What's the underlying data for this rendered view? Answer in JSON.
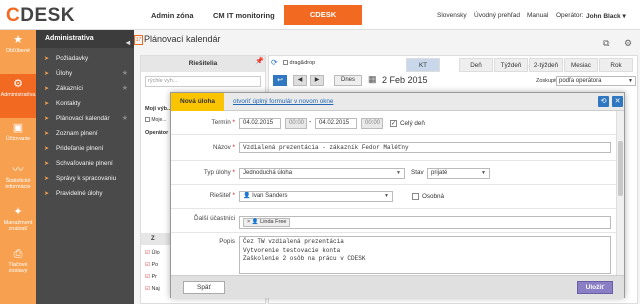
{
  "app": {
    "logo_c": "C",
    "logo_rest": "DESK"
  },
  "topnav": {
    "admin_zone": "Admin zóna",
    "cm_it": "CM IT monitoring",
    "cdesk": "CDESK"
  },
  "topright": {
    "lang": "Slovensky",
    "home": "Úvodný prehľad",
    "manual": "Manual",
    "operator_label": "Operátor:",
    "operator_name": "John Black"
  },
  "leftbar": [
    {
      "label": "Obľúbené",
      "icon": "star-icon"
    },
    {
      "label": "Administratíva",
      "icon": "gear-icon"
    },
    {
      "label": "Účtovanie",
      "icon": "briefcase-icon"
    },
    {
      "label": "Štatistické informácie",
      "icon": "chart-icon"
    },
    {
      "label": "Manažment znalostí",
      "icon": "lightbulb-icon"
    },
    {
      "label": "Tlačové zostavy",
      "icon": "print-icon"
    }
  ],
  "menu": {
    "title": "Administratíva",
    "items": [
      "Požiadavky",
      "Úlohy",
      "Zákazníci",
      "Kontakty",
      "Plánovací kalendár",
      "Zoznam plnení",
      "Prideľanie plnení",
      "Schvaľovanie plnení",
      "Správy k spracovaniu",
      "Pravidelné úlohy"
    ]
  },
  "page": {
    "title": "Plánovací kalendár"
  },
  "resolvers": {
    "title": "Riešitelia",
    "search_placeholder": "rýchle vyh...",
    "my_label": "Moji výb...",
    "my_item": "Moje...",
    "operators": "Operátor",
    "z_label": "Z",
    "checks": [
      "Úlo",
      "Po",
      "Pr",
      "Naj"
    ]
  },
  "calendar": {
    "dragdrop": "drag&drop",
    "today": "Dnes",
    "date": "2 Feb 2015",
    "zoom_label": "Zoskupiť:",
    "zoom_value": "podľa operátora",
    "views": [
      "KT",
      "Deň",
      "Týždeň",
      "2-týždeň",
      "Mesiac",
      "Rok"
    ]
  },
  "modal": {
    "title": "Nová úloha",
    "link": "otvoriť úplný formulár v novom okne",
    "termin_label": "Termín",
    "date_from": "04.02.2015",
    "time_from": "00:00",
    "date_to": "04.02.2015",
    "time_to": "00:00",
    "allday": "Celý deň",
    "name_label": "Názov",
    "name_value": "Vzdialená prezentácia - zákazník Fedor Maléťny",
    "type_label": "Typ úlohy",
    "type_value": "Jednoduchá úloha",
    "state_label": "Stav",
    "state_value": "prijaté",
    "resolver_label": "Riešiteľ",
    "resolver_value": "Ivan Sanders",
    "personal": "Osobná",
    "participants_label": "Ďalší účastníci",
    "participant": "Linda Free",
    "desc_label": "Popis",
    "desc_lines": [
      "Čez TW vzdialená prezentácia",
      "Vytvorenie testovacie konta",
      "Zaškolenie 2 osôb na prácu v CDESK"
    ],
    "back": "Späť",
    "save": "Uložiť"
  },
  "colors": {
    "accent": "#f26a22",
    "sidebar": "#f7a04f",
    "menu": "#4a4a4a",
    "modal_title": "#fbc400",
    "save": "#8a7ec4"
  }
}
